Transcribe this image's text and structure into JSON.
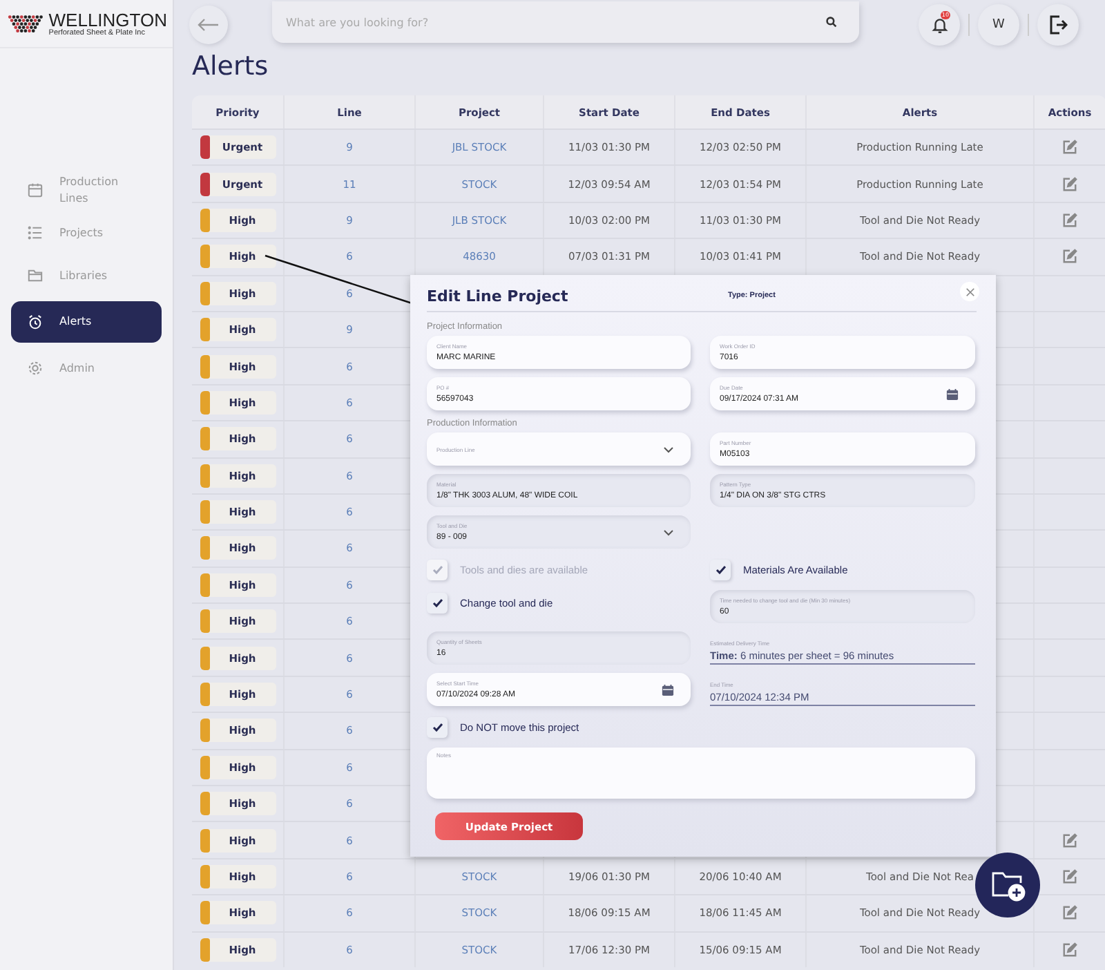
{
  "brand": {
    "name": "WELLINGTON",
    "tagline": "Perforated Sheet & Plate Inc"
  },
  "sidebar": {
    "items": [
      {
        "label": "Production Lines",
        "selected": false
      },
      {
        "label": "Projects",
        "selected": false
      },
      {
        "label": "Libraries",
        "selected": false
      },
      {
        "label": "Alerts",
        "selected": true
      },
      {
        "label": "Admin",
        "selected": false
      }
    ]
  },
  "topbar": {
    "search": {
      "placeholder": "What are you looking for?"
    },
    "notifications": "10",
    "avatar": "W"
  },
  "page_title": "Alerts",
  "table": {
    "columns": [
      "Priority",
      "Line",
      "Project",
      "Start Date",
      "End Dates",
      "Alerts",
      "Actions"
    ],
    "rows": [
      {
        "priority": "Urgent",
        "color": "#c2383f",
        "line": "9",
        "project": "JBL STOCK",
        "start": "11/03 01:30 PM",
        "end": "12/03 02:50 PM",
        "alert": "Production Running Late",
        "edit": true
      },
      {
        "priority": "Urgent",
        "color": "#c2383f",
        "line": "11",
        "project": "STOCK",
        "start": "12/03 09:54 AM",
        "end": "12/03 01:54 PM",
        "alert": "Production Running Late",
        "edit": true
      },
      {
        "priority": "High",
        "color": "#e3a22b",
        "line": "9",
        "project": "JLB STOCK",
        "start": "10/03 02:00 PM",
        "end": "11/03 01:30 PM",
        "alert": "Tool and Die Not Ready",
        "edit": true
      },
      {
        "priority": "High",
        "color": "#e3a22b",
        "line": "6",
        "project": "48630",
        "start": "07/03 01:31 PM",
        "end": "10/03 01:41 PM",
        "alert": "Tool and Die Not Ready",
        "edit": true
      },
      {
        "priority": "High",
        "color": "#e3a22b",
        "line": "6"
      },
      {
        "priority": "High",
        "color": "#e3a22b",
        "line": "9"
      },
      {
        "priority": "High",
        "color": "#e3a22b",
        "line": "6"
      },
      {
        "priority": "High",
        "color": "#e3a22b",
        "line": "6"
      },
      {
        "priority": "High",
        "color": "#e3a22b",
        "line": "6"
      },
      {
        "priority": "High",
        "color": "#e3a22b",
        "line": "6"
      },
      {
        "priority": "High",
        "color": "#e3a22b",
        "line": "6"
      },
      {
        "priority": "High",
        "color": "#e3a22b",
        "line": "6"
      },
      {
        "priority": "High",
        "color": "#e3a22b",
        "line": "6"
      },
      {
        "priority": "High",
        "color": "#e3a22b",
        "line": "6"
      },
      {
        "priority": "High",
        "color": "#e3a22b",
        "line": "6"
      },
      {
        "priority": "High",
        "color": "#e3a22b",
        "line": "6"
      },
      {
        "priority": "High",
        "color": "#e3a22b",
        "line": "6"
      },
      {
        "priority": "High",
        "color": "#e3a22b",
        "line": "6"
      },
      {
        "priority": "High",
        "color": "#e3a22b",
        "line": "6"
      },
      {
        "priority": "High",
        "color": "#e3a22b",
        "line": "6",
        "edit": true
      },
      {
        "priority": "High",
        "color": "#e3a22b",
        "line": "6",
        "project": "STOCK",
        "start": "19/06 01:30 PM",
        "end": "20/06 10:40 AM",
        "alert": "Tool and Die Not Rea",
        "edit": true
      },
      {
        "priority": "High",
        "color": "#e3a22b",
        "line": "6",
        "project": "STOCK",
        "start": "18/06 09:15 AM",
        "end": "18/06 11:45 AM",
        "alert": "Tool and Die Not Ready",
        "edit": true
      },
      {
        "priority": "High",
        "color": "#e3a22b",
        "line": "6",
        "project": "STOCK",
        "start": "17/06 12:30 PM",
        "end": "15/06 09:15 AM",
        "alert": "Tool and Die Not Ready",
        "edit": true
      }
    ]
  },
  "modal": {
    "title": "Edit Line Project",
    "type": "Type: Project",
    "button": "Update Project",
    "rows": [
      [
        {
          "kind": "heading",
          "text": "Project Information"
        }
      ],
      [
        {
          "kind": "field",
          "label": "Client Name",
          "value": "MARC MARINE"
        },
        {
          "kind": "field",
          "label": "Work Order ID",
          "value": "7016"
        }
      ],
      [
        {
          "kind": "field",
          "label": "PO #",
          "value": "56597043"
        },
        {
          "kind": "date",
          "label": "Due Date",
          "value": "09/17/2024 07:31 AM"
        }
      ],
      [
        {
          "kind": "heading",
          "text": "Production Information"
        }
      ],
      [
        {
          "kind": "select",
          "label": "Production Line"
        },
        {
          "kind": "field",
          "label": "Part Number",
          "value": "M05103"
        }
      ],
      [
        {
          "kind": "inset",
          "label": "Material",
          "value": "1/8\" THK 3003 ALUM, 48\" WIDE COIL"
        },
        {
          "kind": "inset",
          "label": "Pattern Type",
          "value": "1/4\" DIA ON 3/8\" STG CTRS"
        }
      ],
      [
        {
          "kind": "inset-select",
          "label": "Tool and Die",
          "value": "89 - 009"
        }
      ],
      [
        {
          "kind": "checkbox",
          "label": "Tools and dies are available",
          "checked": true,
          "disabled": true
        },
        {
          "kind": "checkbox",
          "label": "Materials Are Available",
          "checked": true,
          "disabled": false
        }
      ],
      [
        {
          "kind": "checkbox",
          "label": "Change tool and die",
          "checked": true,
          "disabled": false
        },
        {
          "kind": "inset",
          "label": "Time needed to change tool and die (Min 30 minutes)",
          "value": "60"
        }
      ],
      [
        {
          "kind": "inset",
          "label": "Quantity of Sheets",
          "value": "16"
        },
        {
          "kind": "display",
          "label": "Estimated Delivery Time",
          "value": "**Time:** 6 minutes per sheet = 96 minutes"
        }
      ],
      [
        {
          "kind": "date",
          "label": "Select Start Time",
          "value": "07/10/2024 09:28 AM"
        },
        {
          "kind": "display",
          "label": "End Time",
          "value": "07/10/2024 12:34 PM"
        }
      ],
      [
        {
          "kind": "checkbox",
          "label": "Do NOT move this project",
          "checked": true,
          "disabled": false
        }
      ],
      [
        {
          "kind": "notes",
          "label": "Notes"
        }
      ]
    ]
  }
}
